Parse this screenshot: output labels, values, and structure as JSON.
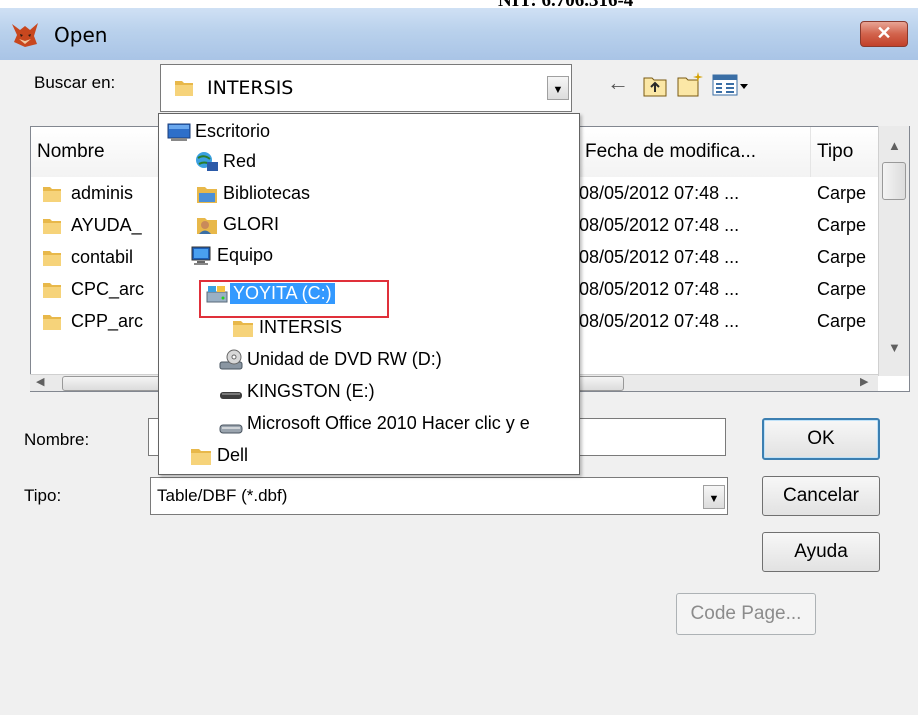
{
  "top_partial_text": "NIT: 6.706.316-4",
  "window": {
    "title": "Open",
    "close_label": "✕"
  },
  "lookin": {
    "label": "Buscar en:",
    "value": "INTERSIS"
  },
  "columns": [
    "Nombre",
    "Fecha de modifica...",
    "Tipo"
  ],
  "rows": [
    {
      "name": "adminis",
      "date": "08/05/2012 07:48 ...",
      "type": "Carpe"
    },
    {
      "name": "AYUDA_",
      "date": "08/05/2012 07:48 ...",
      "type": "Carpe"
    },
    {
      "name": "contabil",
      "date": "08/05/2012 07:48 ...",
      "type": "Carpe"
    },
    {
      "name": "CPC_arc",
      "date": "08/05/2012 07:48 ...",
      "type": "Carpe"
    },
    {
      "name": "CPP_arc",
      "date": "08/05/2012 07:48 ...",
      "type": "Carpe"
    }
  ],
  "dropdown_items": [
    {
      "label": "Escritorio",
      "icon": "desktop-icon"
    },
    {
      "label": "Red",
      "icon": "network-icon"
    },
    {
      "label": "Bibliotecas",
      "icon": "libraries-icon"
    },
    {
      "label": "GLORI",
      "icon": "user-icon"
    },
    {
      "label": "Equipo",
      "icon": "computer-icon"
    },
    {
      "label": "YOYITA (C:)",
      "icon": "hard-drive-icon"
    },
    {
      "label": "INTERSIS",
      "icon": "folder-icon"
    },
    {
      "label": "Unidad de DVD RW (D:)",
      "icon": "dvd-drive-icon"
    },
    {
      "label": "KINGSTON (E:)",
      "icon": "usb-drive-icon"
    },
    {
      "label": "Microsoft Office 2010 Hacer clic y e",
      "icon": "virtual-drive-icon"
    },
    {
      "label": "Dell",
      "icon": "folder-icon"
    }
  ],
  "filename": {
    "label": "Nombre:",
    "value": ""
  },
  "filetype": {
    "label": "Tipo:",
    "value": "Table/DBF (*.dbf)"
  },
  "buttons": {
    "ok": "OK",
    "cancel": "Cancelar",
    "help": "Ayuda",
    "codepage": "Code Page..."
  },
  "colors": {
    "selection": "#3399ff",
    "highlight_border": "#e0303a",
    "close_button": "#c2412a"
  }
}
